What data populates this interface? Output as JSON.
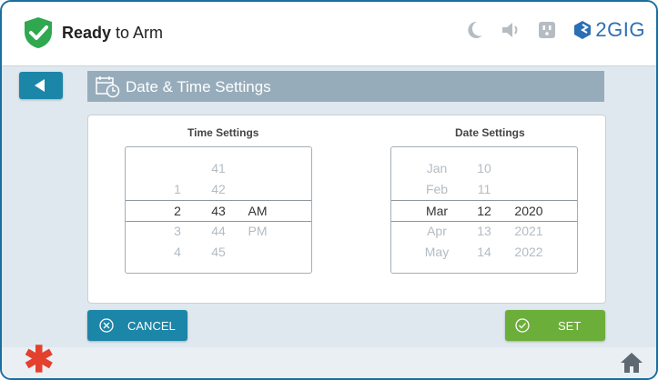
{
  "header": {
    "status_bold": "Ready",
    "status_rest": " to Arm",
    "brand": "2GIG",
    "icons": [
      "moon-icon",
      "speaker-icon",
      "outlet-icon"
    ],
    "shield_color": "#2fa84f"
  },
  "page": {
    "title": "Date & Time Settings"
  },
  "time_settings": {
    "title": "Time Settings",
    "rows": [
      {
        "hour": "",
        "minute": "41",
        "ampm": ""
      },
      {
        "hour": "1",
        "minute": "42",
        "ampm": ""
      },
      {
        "hour": "2",
        "minute": "43",
        "ampm": "AM"
      },
      {
        "hour": "3",
        "minute": "44",
        "ampm": "PM"
      },
      {
        "hour": "4",
        "minute": "45",
        "ampm": ""
      }
    ]
  },
  "date_settings": {
    "title": "Date Settings",
    "rows": [
      {
        "month": "Jan",
        "day": "10",
        "year": ""
      },
      {
        "month": "Feb",
        "day": "11",
        "year": ""
      },
      {
        "month": "Mar",
        "day": "12",
        "year": "2020"
      },
      {
        "month": "Apr",
        "day": "13",
        "year": "2021"
      },
      {
        "month": "May",
        "day": "14",
        "year": "2022"
      }
    ]
  },
  "actions": {
    "cancel_label": "CANCEL",
    "set_label": "SET"
  },
  "colors": {
    "accent": "#1c86a8",
    "set_green": "#6cae3a",
    "emergency_red": "#e4402e"
  }
}
